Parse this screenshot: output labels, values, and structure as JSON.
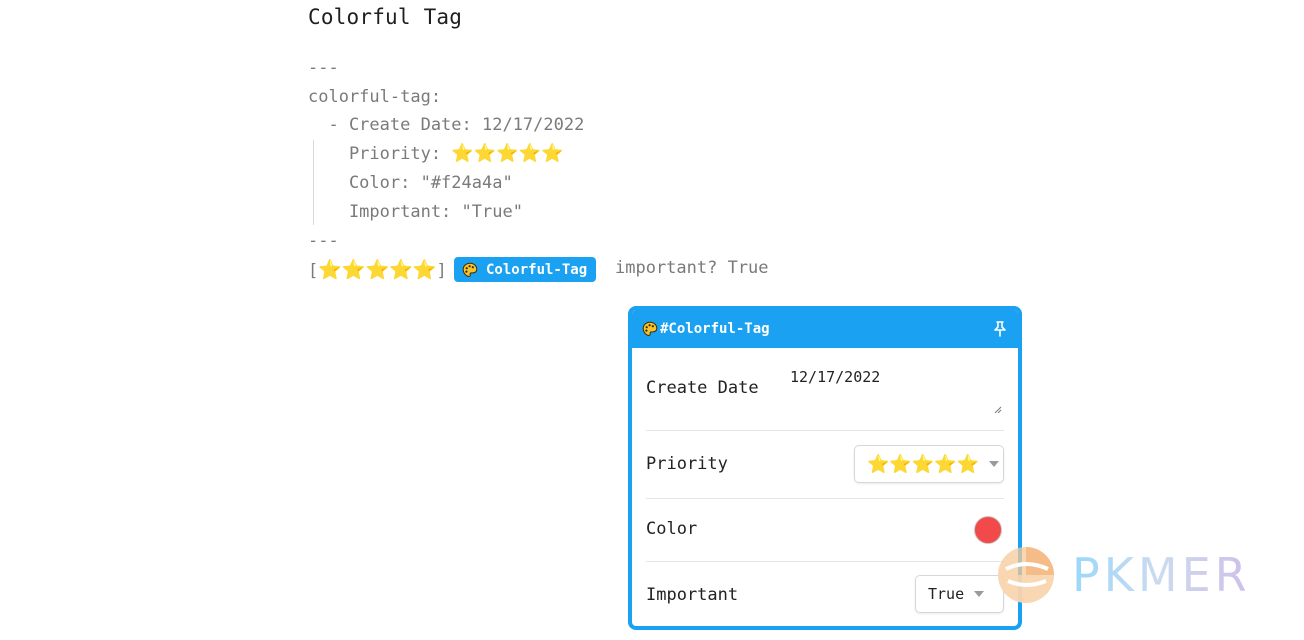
{
  "page": {
    "title": "Colorful Tag"
  },
  "code": {
    "frontmatter_open": "---",
    "key": "colorful-tag:",
    "create_date_line": "  - Create Date: 12/17/2022",
    "priority_label": "    Priority: ",
    "priority_stars": "⭐⭐⭐⭐⭐",
    "color_line": "    Color: \"#f24a4a\"",
    "important_line": "    Important: \"True\"",
    "frontmatter_close": "---"
  },
  "inline": {
    "bracket_open": "[",
    "stars": "⭐⭐⭐⭐⭐",
    "bracket_close": "]",
    "tag_label": "Colorful-Tag",
    "important_text": "important? True"
  },
  "popup": {
    "title": "#Colorful-Tag",
    "fields": {
      "create_date_label": "Create Date",
      "create_date_value": "12/17/2022",
      "priority_label": "Priority",
      "priority_value": "⭐⭐⭐⭐⭐",
      "color_label": "Color",
      "color_value": "#f24a4a",
      "important_label": "Important",
      "important_value": "True"
    }
  },
  "colors": {
    "accent": "#1ba1f2",
    "tag_color": "#f24a4a"
  },
  "icons": {
    "tag_icon": "palette-icon",
    "pin_icon": "pin-icon"
  },
  "watermark": {
    "text": "PKMER"
  }
}
